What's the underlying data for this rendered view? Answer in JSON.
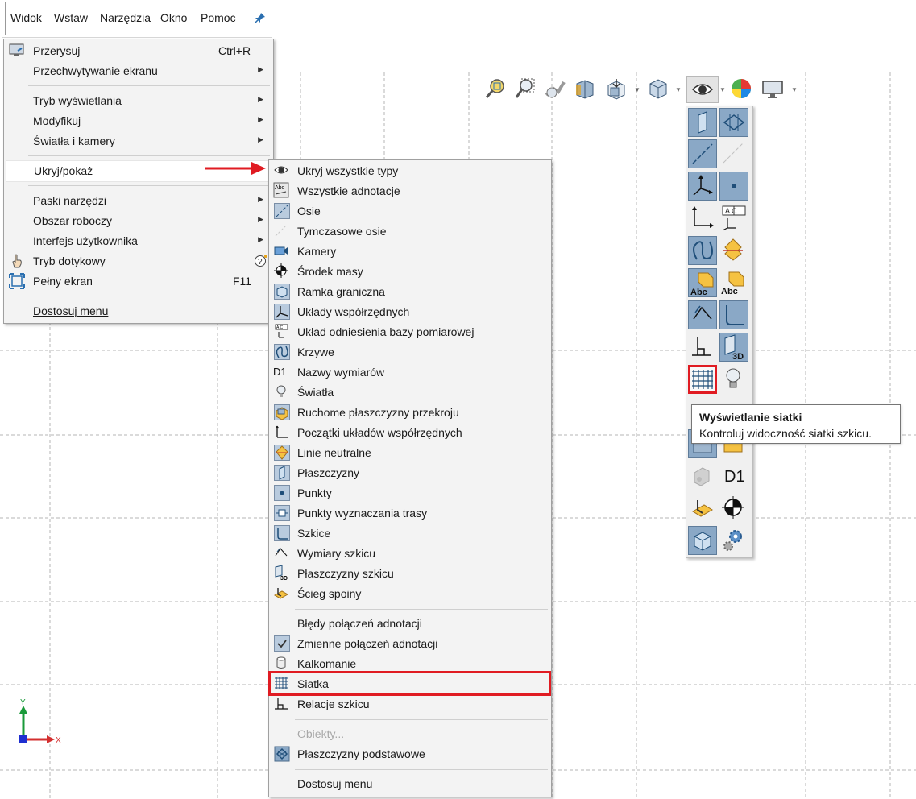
{
  "menubar": {
    "items": [
      "Widok",
      "Wstaw",
      "Narzędzia",
      "Okno",
      "Pomoc"
    ]
  },
  "view_menu": {
    "redraw": {
      "label": "Przerysuj",
      "shortcut": "Ctrl+R"
    },
    "screen_capture": "Przechwytywanie ekranu",
    "display_mode": "Tryb wyświetlania",
    "modify": "Modyfikuj",
    "lights_cameras": "Światła i kamery",
    "hide_show": "Ukryj/pokaż",
    "toolbars": "Paski narzędzi",
    "workspace": "Obszar roboczy",
    "user_interface": "Interfejs użytkownika",
    "touch_mode": "Tryb dotykowy",
    "full_screen": {
      "label": "Pełny ekran",
      "shortcut": "F11"
    },
    "customize": "Dostosuj menu"
  },
  "submenu": {
    "items": [
      "Ukryj wszystkie typy",
      "Wszystkie adnotacje",
      "Osie",
      "Tymczasowe osie",
      "Kamery",
      "Środek masy",
      "Ramka graniczna",
      "Układy współrzędnych",
      "Układ odniesienia bazy pomiarowej",
      "Krzywe",
      "Nazwy wymiarów",
      "Światła",
      "Ruchome płaszczyzny przekroju",
      "Początki układów współrzędnych",
      "Linie neutralne",
      "Płaszczyzny",
      "Punkty",
      "Punkty wyznaczania trasy",
      "Szkice",
      "Wymiary szkicu",
      "Płaszczyzny szkicu",
      "Ścieg spoiny"
    ],
    "items2": [
      "Błędy połączeń adnotacji",
      "Zmienne połączeń adnotacji",
      "Kalkomanie",
      "Siatka",
      "Relacje szkicu"
    ],
    "disabled": "Obiekty...",
    "base_planes": "Płaszczyzny podstawowe",
    "customize": "Dostosuj menu",
    "d1_icon_text": "D1"
  },
  "panel": {
    "abc": "Abc",
    "ac": "A C",
    "threed": "3D",
    "d1": "D1"
  },
  "tooltip": {
    "title": "Wyświetlanie siatki",
    "text": "Kontroluj widoczność siatki szkicu."
  },
  "triad": {
    "y": "Y",
    "x": "X"
  },
  "colors": {
    "highlight": "#e01b22",
    "arrow": "#e01b22",
    "menu_bg": "#f3f3f3",
    "pressed": "#8aa8c6"
  }
}
